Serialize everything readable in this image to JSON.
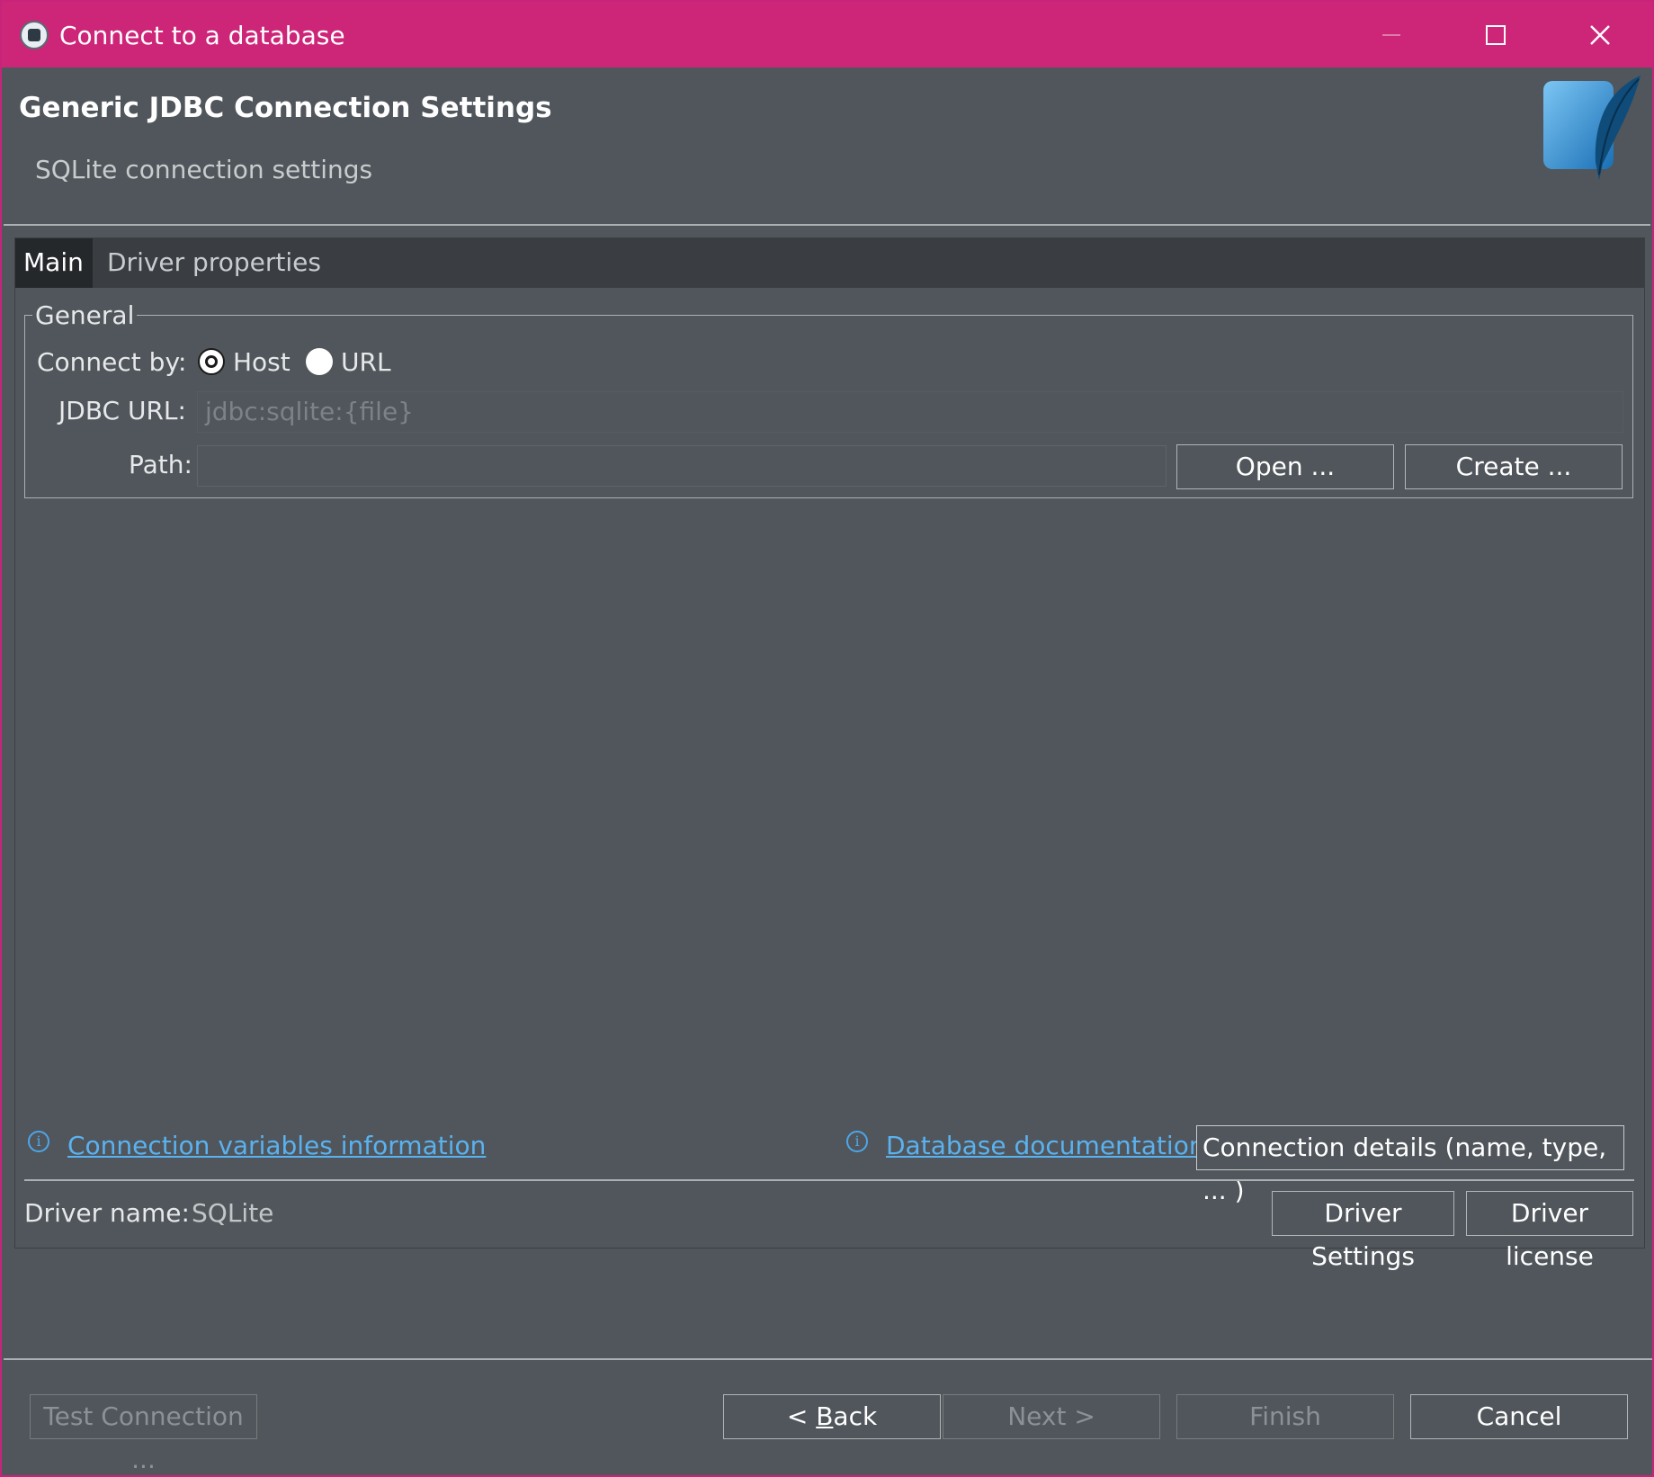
{
  "window": {
    "title": "Connect to a database",
    "accent_color": "#cd2679"
  },
  "header": {
    "title": "Generic JDBC Connection Settings",
    "subtitle": "SQLite connection settings"
  },
  "tabs": [
    {
      "label": "Main",
      "active": true
    },
    {
      "label": "Driver properties",
      "active": false
    }
  ],
  "general": {
    "legend": "General",
    "connect_by_label": "Connect by:",
    "options": [
      {
        "label": "Host",
        "selected": true
      },
      {
        "label": "URL",
        "selected": false
      }
    ],
    "jdbc_url_label": "JDBC URL:",
    "jdbc_url_value": "jdbc:sqlite:{file}",
    "path_label": "Path:",
    "path_value": "",
    "open_button": "Open ...",
    "create_button": "Create ..."
  },
  "info_links": {
    "connection_variables": "Connection variables information",
    "database_documentation": "Database documentation",
    "connection_details_button": "Connection details (name, type, ... )"
  },
  "driver": {
    "name_label": "Driver name:",
    "name_value": "SQLite",
    "settings_button": "Driver Settings",
    "license_button": "Driver license"
  },
  "footer": {
    "test_connection": "Test Connection ...",
    "back_prefix": "< ",
    "back_accel": "B",
    "back_rest": "ack",
    "next": "Next >",
    "finish": "Finish",
    "cancel": "Cancel"
  }
}
